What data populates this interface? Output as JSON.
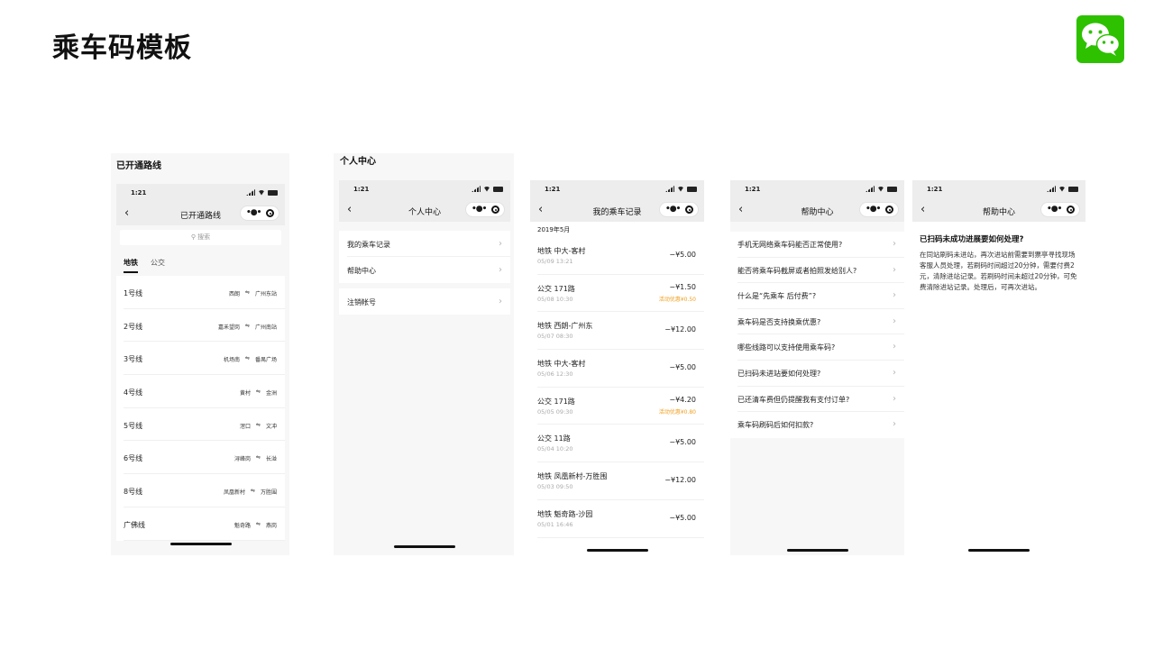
{
  "title": "乘车码模板",
  "brand_color": "#2dc100",
  "logo_icon": "wechat-icon",
  "status_time": "1:21",
  "screens": {
    "lines": {
      "section_label": "已开通路线",
      "nav_title": "已开通路线",
      "search_placeholder": "搜索",
      "tabs": [
        {
          "label": "地铁",
          "active": true
        },
        {
          "label": "公交",
          "active": false
        }
      ],
      "route_separator": "⇋",
      "lines": [
        {
          "name": "1号线",
          "from": "西朗",
          "to": "广州东站"
        },
        {
          "name": "2号线",
          "from": "嘉禾望岗",
          "to": "广州南站"
        },
        {
          "name": "3号线",
          "from": "机场南",
          "to": "番禺广场"
        },
        {
          "name": "4号线",
          "from": "黄村",
          "to": "金洲"
        },
        {
          "name": "5号线",
          "from": "滘口",
          "to": "文冲"
        },
        {
          "name": "6号线",
          "from": "浔峰岗",
          "to": "长湴"
        },
        {
          "name": "8号线",
          "from": "凤凰新村",
          "to": "万胜围"
        },
        {
          "name": "广佛线",
          "from": "魁奇路",
          "to": "燕岗"
        }
      ]
    },
    "profile": {
      "section_label": "个人中心",
      "nav_title": "个人中心",
      "menu": [
        "我的乘车记录",
        "帮助中心"
      ],
      "account_menu": [
        "注销帐号"
      ]
    },
    "records": {
      "nav_title": "我的乘车记录",
      "month": "2019年5月",
      "records": [
        {
          "title": "地铁  中大-客村",
          "date": "05/09  13:21",
          "amount": "−¥5.00",
          "discount": ""
        },
        {
          "title": "公交 171路",
          "date": "05/08  10:30",
          "amount": "−¥1.50",
          "discount": "活动优惠¥0.50"
        },
        {
          "title": "地铁  西朗-广州东",
          "date": "05/07  08:30",
          "amount": "−¥12.00",
          "discount": ""
        },
        {
          "title": "地铁  中大-客村",
          "date": "05/06  12:30",
          "amount": "−¥5.00",
          "discount": ""
        },
        {
          "title": "公交 171路",
          "date": "05/05  09:30",
          "amount": "−¥4.20",
          "discount": "活动优惠¥0.80"
        },
        {
          "title": "公交 11路",
          "date": "05/04  10:20",
          "amount": "−¥5.00",
          "discount": ""
        },
        {
          "title": "地铁  凤凰新村-万胜围",
          "date": "05/03  09:50",
          "amount": "−¥12.00",
          "discount": ""
        },
        {
          "title": "地铁  魁奇路-沙园",
          "date": "05/01  16:46",
          "amount": "−¥5.00",
          "discount": ""
        }
      ]
    },
    "help": {
      "nav_title": "帮助中心",
      "questions": [
        "手机无网络乘车码能否正常使用?",
        "能否将乘车码截屏或者拍照发给别人?",
        "什么是“先乘车 后付费”?",
        "乘车码是否支持换乘优惠?",
        "哪些线路可以支持使用乘车码?",
        "已扫码未进站要如何处理?",
        "已还清车费但仍提醒我有支付订单?",
        "乘车码刷码后如何扣款?"
      ]
    },
    "answer": {
      "nav_title": "帮助中心",
      "question": "已扫码未成功进展要如何处理?",
      "body": "在同站刷码未进站，再次进站前需要到票亭寻找现场客服人员处理，若刷码时间超过20分钟，需要付费2元，清除进站记录。若刷码时间未超过20分钟，可免费清除进站记录。处理后，可再次进站。"
    }
  }
}
